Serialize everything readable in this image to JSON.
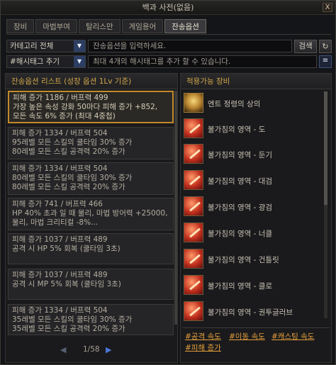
{
  "window": {
    "title": "백과 사전(없음)",
    "close_label": "X"
  },
  "tabs": [
    {
      "label": "장비",
      "active": false
    },
    {
      "label": "마법부여",
      "active": false
    },
    {
      "label": "탈리스만",
      "active": false
    },
    {
      "label": "게임용어",
      "active": false
    },
    {
      "label": "잔송옵션",
      "active": true
    }
  ],
  "filters": {
    "category_select": "카테고리 전체",
    "search_placeholder": "잔송옵션을 입력하세요.",
    "search_button": "검색",
    "refresh_icon": "↻",
    "hashtag_select": "#해시태그 추기",
    "hashtag_placeholder": "최대 4개의 해시태그를 추가 할 수 있습니다.",
    "more_button": "≡"
  },
  "left_panel": {
    "title": "잔송옵션 리스트 (성장 옵션 1Lv 기준)",
    "entries": [
      {
        "lines": [
          "피해 증가 1186 / 버프력 499",
          "가장 높은 속성 강화 50마다 피해 증가 +852,",
          "모든 속도 6% 증가 (최대 4중첩)"
        ],
        "selected": true
      },
      {
        "lines": [
          "피해 증가 1334 / 버프력 504",
          "95레벨 모든 스킬의 쿨타임 30% 증가",
          "80레벨 모든 스킬 공격력 20% 증가"
        ],
        "selected": false
      },
      {
        "lines": [
          "피해 증가 1334 / 버프력 504",
          "80레벨 모든 스킬의 쿨타임 30% 증가",
          "80레벨 모든 스킬 공격력 20% 증가"
        ],
        "selected": false
      },
      {
        "lines": [
          "피해 증가 741 / 버프력 466",
          "HP 40% 초과 일 때 물리, 마법 방어력 +25000,",
          "물리, 마법 크리티컬 -8%..."
        ],
        "selected": false
      },
      {
        "lines": [
          "피해 증가 1037 / 버프력 489",
          "공격 시 HP 5% 회복 (쿨타임 3초)"
        ],
        "selected": false
      },
      {
        "lines": [
          "피해 증가 1037 / 버프력 489",
          "공격 시 MP 5% 회복 (쿨타임 3초)"
        ],
        "selected": false
      },
      {
        "lines": [
          "피해 증가 1334 / 버프력 504",
          "35레벨 모든 스킬의 쿨타임 30% 증가",
          "35레벨 모든 스킬 공격력 20% 증가"
        ],
        "selected": false
      }
    ],
    "pager": {
      "prev": "◀",
      "page": "1/58",
      "next": "▶"
    }
  },
  "right_panel": {
    "title": "적용가능 장비",
    "items": [
      {
        "name": "엔트 정령의 상의",
        "icon": "cloak-icon"
      },
      {
        "name": "불가침의 영역 - 도",
        "icon": "weapon-icon"
      },
      {
        "name": "불가침의 영역 - 둔기",
        "icon": "weapon-icon"
      },
      {
        "name": "불가침의 영역 - 대검",
        "icon": "weapon-icon"
      },
      {
        "name": "불가침의 영역 - 광검",
        "icon": "weapon-icon"
      },
      {
        "name": "불가침의 영역 - 너클",
        "icon": "weapon-icon"
      },
      {
        "name": "불가침의 영역 - 건틀릿",
        "icon": "weapon-icon"
      },
      {
        "name": "불가침의 영역 - 클로",
        "icon": "weapon-icon"
      },
      {
        "name": "불가침의 영역 - 권투글러브",
        "icon": "weapon-icon"
      }
    ],
    "hashtags": [
      "#공격 속도",
      "#이동 속도",
      "#캐스팅 속도",
      "#피해 증가"
    ]
  },
  "colors": {
    "accent_gold": "#c38a2a",
    "hashtag_orange": "#e7a13a",
    "header_gold": "#d2a64a",
    "button_blue": "#2c3e63"
  }
}
